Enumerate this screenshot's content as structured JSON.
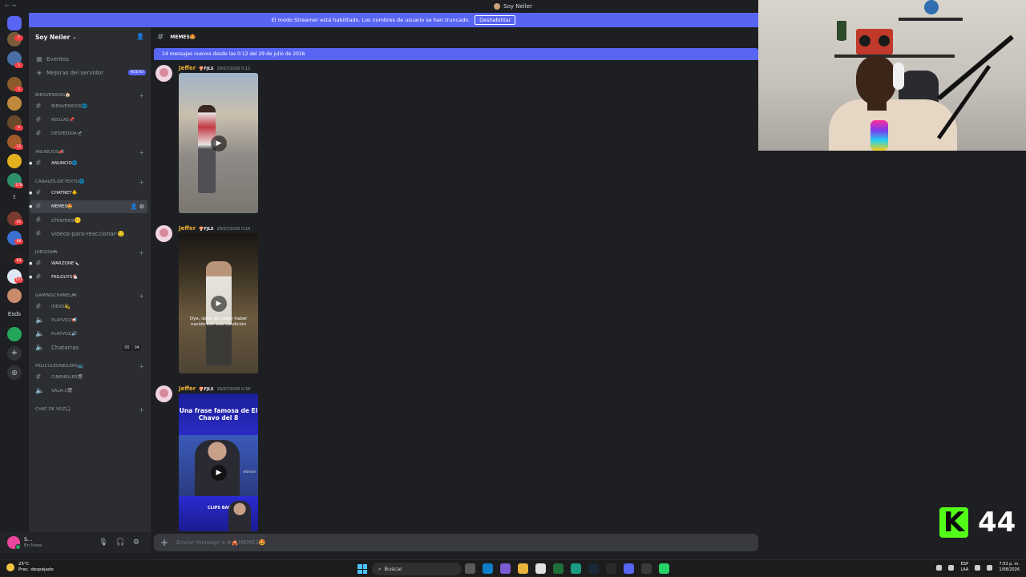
{
  "window": {
    "title": "Soy Neiler"
  },
  "streamer_banner": {
    "text": "El modo Streamer está habilitado. Los nombres de usuario se han truncado.",
    "button": "Deshabilitar"
  },
  "server_rail": {
    "badges": [
      "7",
      "5",
      "1",
      "2",
      "11",
      "4",
      "42",
      "12",
      "178",
      "41",
      "88",
      "64",
      "167"
    ],
    "text_item": "Esds",
    "text_t": "t"
  },
  "server": {
    "name": "Soy Neiler"
  },
  "sidebar": {
    "events": "Eventos",
    "boosts": "Mejoras del servidor",
    "boosts_badge": "NUEVO",
    "categories": [
      {
        "name": "BIENVENIDAS🏠",
        "channels": [
          "BIENVENIDOS🌐",
          "REGLAS📌",
          "DESPEDIDA🛫"
        ]
      },
      {
        "name": "ANUNCIOS📣",
        "channels": [
          "ANUNCIO🌐"
        ]
      },
      {
        "name": "CANALES-DE-TEXTO🌐",
        "channels": [
          "CHATNET🐥",
          "MEMES🤩",
          "chismes🤫",
          "videos-para-reaccionar-🙂"
        ]
      },
      {
        "name": "JUEGOS🎮",
        "channels": [
          "WARZONE🔪",
          "FAILGUYS🐔"
        ]
      },
      {
        "name": "GAMINGCHANEL🎮",
        "channels": [
          "IDEAS💫",
          "PLAYVOZ📢",
          "PLAYVOZ🔊",
          "Chatarras"
        ]
      },
      {
        "name": "PELICULEONEILERS📺",
        "channels": [
          "CINENEILER🎬",
          "SALA-1🎬"
        ]
      },
      {
        "name": "CHAT DE VOZ🎧",
        "channels": []
      }
    ],
    "chatarras_counts": [
      "00",
      "04"
    ]
  },
  "user_panel": {
    "name": "S...",
    "status": "En línea"
  },
  "channel": {
    "name": "MEMES🤩",
    "new_messages": "14 mensajes nuevos desde las 0:12 del 29 de julio de 2026",
    "composer_placeholder": "Enviar mensaje a #🎪MEMES🤩"
  },
  "messages": [
    {
      "author": "Jeffer",
      "tag": "🍄FJLS",
      "time": "29/07/2026 0:12"
    },
    {
      "author": "Jeffer",
      "tag": "🍄FJLS",
      "time": "29/07/2026 0:24",
      "subtitle": "Oye, debe de saber haber nacido con esa condición"
    },
    {
      "author": "Jeffer",
      "tag": "🍄FJLS",
      "time": "29/07/2026 0:39",
      "video_title": "Una frase famosa de El Chavo del 8",
      "video_label": "eltrece",
      "clip_label": "CLIPS BARAZO"
    }
  ],
  "overlay": {
    "k_letter": "K",
    "viewers": "44"
  },
  "taskbar": {
    "weather_temp": "25°C",
    "weather_desc": "Prac. despejado",
    "search": "Buscar",
    "lang1": "ESP",
    "lang2": "LAA",
    "time": "7:53 p. m.",
    "date": "1/08/2026"
  }
}
